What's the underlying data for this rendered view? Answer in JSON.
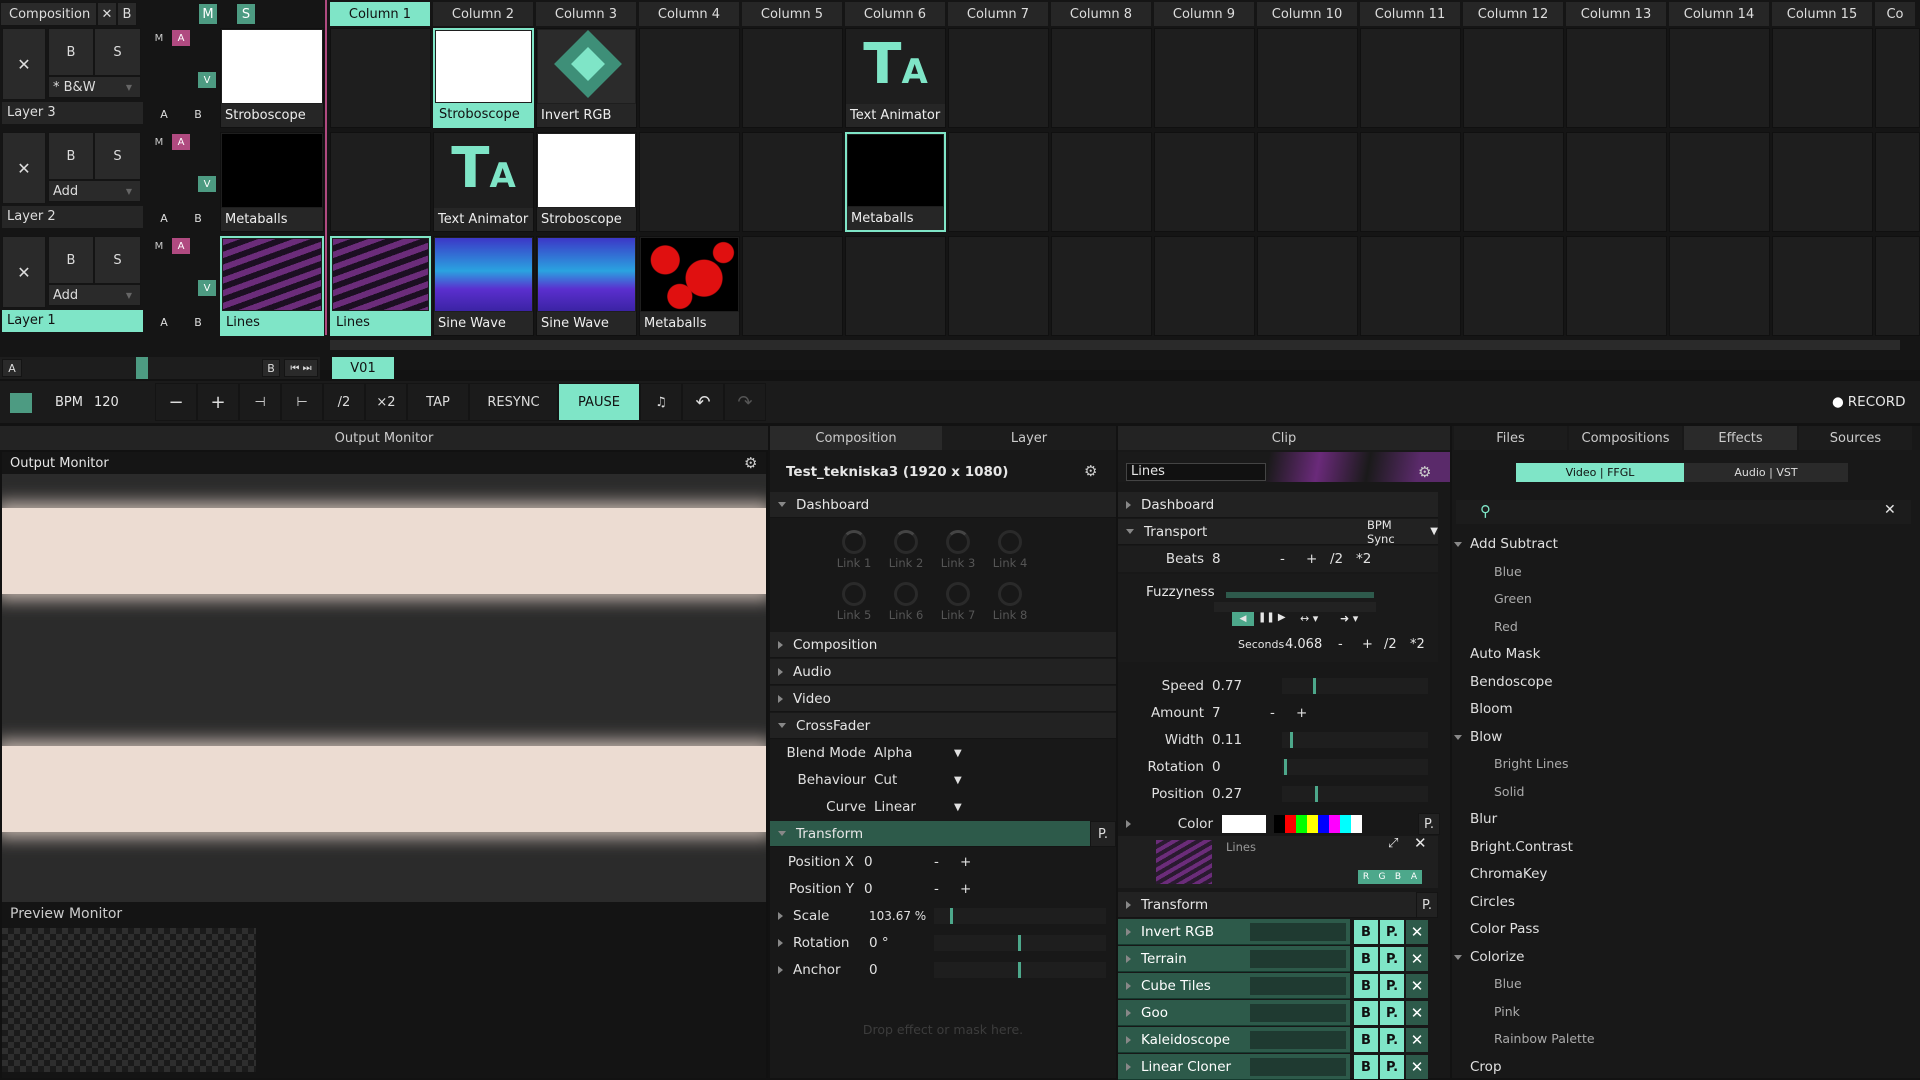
{
  "composition": {
    "label": "Composition",
    "x": "✕",
    "b": "B",
    "m": "M",
    "s": "S"
  },
  "columns": [
    "Column 1",
    "Column 2",
    "Column 3",
    "Column 4",
    "Column 5",
    "Column 6",
    "Column 7",
    "Column 8",
    "Column 9",
    "Column 10",
    "Column 11",
    "Column 12",
    "Column 13",
    "Column 14",
    "Column 15",
    "Co"
  ],
  "layers": [
    {
      "name": "Layer 3",
      "blend": "* B&W",
      "b": "B",
      "s": "S",
      "m": "M",
      "a": "A",
      "v": "V",
      "ab_a": "A",
      "ab_b": "B"
    },
    {
      "name": "Layer 2",
      "blend": "Add",
      "b": "B",
      "s": "S",
      "m": "M",
      "a": "A",
      "v": "V",
      "ab_a": "A",
      "ab_b": "B"
    },
    {
      "name": "Layer 1",
      "blend": "Add",
      "b": "B",
      "s": "S",
      "m": "M",
      "a": "A",
      "v": "V",
      "ab_a": "A",
      "ab_b": "B"
    }
  ],
  "clips": {
    "row1": [
      "Stroboscope",
      "",
      "Stroboscope",
      "Invert RGB",
      "",
      "",
      "Text Animator"
    ],
    "row2": [
      "Metaballs",
      "",
      "Text Animator",
      "Stroboscope",
      "",
      "",
      "Metaballs"
    ],
    "row3": [
      "Lines",
      "Lines",
      "Sine Wave",
      "Sine Wave",
      "Metaballs"
    ]
  },
  "crossfader": {
    "a": "A",
    "b": "B",
    "deck": "V01"
  },
  "transport": {
    "bpm_label": "BPM",
    "bpm": "120",
    "minus": "−",
    "plus": "+",
    "half": "/2",
    "double": "×2",
    "tap": "TAP",
    "resync": "RESYNC",
    "pause": "PAUSE",
    "record": "RECORD"
  },
  "output": {
    "header": "Output Monitor",
    "title": "Output Monitor",
    "preview": "Preview Monitor"
  },
  "middle": {
    "tab_comp": "Composition",
    "tab_layer": "Layer",
    "title": "Test_tekniska3 (1920 x 1080)",
    "dashboard": "Dashboard",
    "links": [
      "Link 1",
      "Link 2",
      "Link 3",
      "Link 4",
      "Link 5",
      "Link 6",
      "Link 7",
      "Link 8"
    ],
    "sections": [
      "Composition",
      "Audio",
      "Video",
      "CrossFader"
    ],
    "blend_mode_l": "Blend Mode",
    "blend_mode": "Alpha",
    "behaviour_l": "Behaviour",
    "behaviour": "Cut",
    "curve_l": "Curve",
    "curve": "Linear",
    "transform": "Transform",
    "p": "P.",
    "posx_l": "Position X",
    "posx": "0",
    "posy_l": "Position Y",
    "posy": "0",
    "scale_l": "Scale",
    "scale": "103.67 %",
    "rotation_l": "Rotation",
    "rotation": "0 °",
    "anchor_l": "Anchor",
    "anchor": "0",
    "drop": "Drop effect or mask here."
  },
  "clip": {
    "tab": "Clip",
    "name": "Lines",
    "dashboard": "Dashboard",
    "transport": "Transport",
    "bpm_sync": "BPM Sync",
    "beats_l": "Beats",
    "beats": "8",
    "minus": "-",
    "plus": "+",
    "half": "/2",
    "double": "*2",
    "fuzzy_l": "Fuzzyness",
    "seconds_l": "Seconds",
    "seconds": "4.068",
    "speed_l": "Speed",
    "speed": "0.77",
    "amount_l": "Amount",
    "amount": "7",
    "width_l": "Width",
    "width": "0.11",
    "rotation_l": "Rotation",
    "rotation": "0",
    "position_l": "Position",
    "position": "0.27",
    "color_l": "Color",
    "src_label": "Lines",
    "rgba": [
      "R",
      "G",
      "B",
      "A"
    ],
    "transform": "Transform",
    "p": "P.",
    "effects": [
      "Invert RGB",
      "Terrain",
      "Cube Tiles",
      "Goo",
      "Kaleidoscope",
      "Linear Cloner"
    ]
  },
  "browser": {
    "tabs": [
      "Files",
      "Compositions",
      "Effects",
      "Sources"
    ],
    "video": "Video | FFGL",
    "audio": "Audio | VST",
    "items": [
      [
        "Add Subtract",
        0,
        1
      ],
      [
        "Blue",
        1,
        0
      ],
      [
        "Green",
        1,
        0
      ],
      [
        "Red",
        1,
        0
      ],
      [
        "Auto Mask",
        0,
        0
      ],
      [
        "Bendoscope",
        0,
        0
      ],
      [
        "Bloom",
        0,
        0
      ],
      [
        "Blow",
        0,
        1
      ],
      [
        "Bright Lines",
        1,
        0
      ],
      [
        "Solid",
        1,
        0
      ],
      [
        "Blur",
        0,
        0
      ],
      [
        "Bright.Contrast",
        0,
        0
      ],
      [
        "ChromaKey",
        0,
        0
      ],
      [
        "Circles",
        0,
        0
      ],
      [
        "Color Pass",
        0,
        0
      ],
      [
        "Colorize",
        0,
        1
      ],
      [
        "Blue",
        1,
        0
      ],
      [
        "Pink",
        1,
        0
      ],
      [
        "Rainbow Palette",
        1,
        0
      ],
      [
        "Crop",
        0,
        0
      ]
    ]
  }
}
